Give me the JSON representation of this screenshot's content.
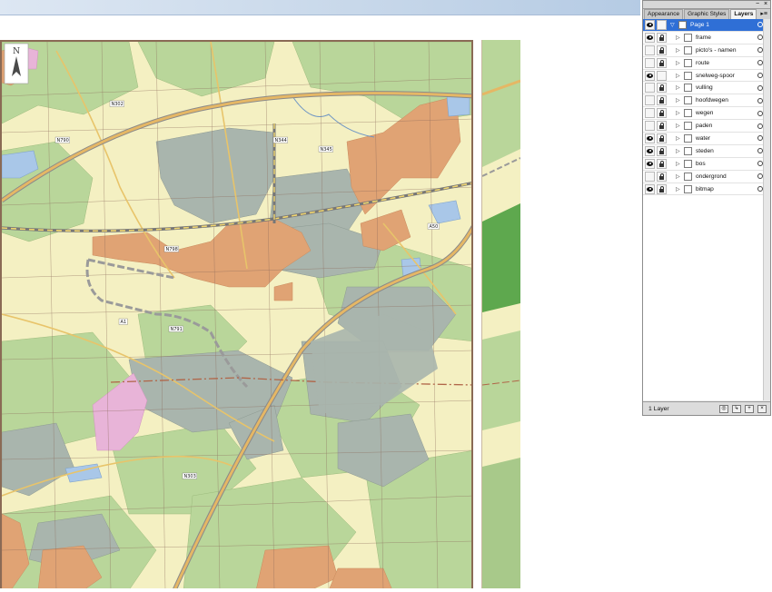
{
  "layers_panel": {
    "tabs": [
      {
        "label": "Appearance",
        "active": false
      },
      {
        "label": "Graphic Styles",
        "active": false
      },
      {
        "label": "Layers",
        "active": true
      }
    ],
    "menu_icon": "panel-menu-icon",
    "close_glyph": "×",
    "minimize_glyph": "−",
    "top_layer": {
      "name": "Page 1",
      "selected": true
    },
    "sublayers": [
      {
        "name": "frame",
        "visible": true,
        "locked": true
      },
      {
        "name": "picto's - namen",
        "visible": false,
        "locked": true
      },
      {
        "name": "route",
        "visible": false,
        "locked": true
      },
      {
        "name": "snelweg-spoor",
        "visible": true,
        "locked": false
      },
      {
        "name": "vulling",
        "visible": false,
        "locked": true
      },
      {
        "name": "hoofdwegen",
        "visible": false,
        "locked": true
      },
      {
        "name": "wegen",
        "visible": false,
        "locked": true
      },
      {
        "name": "paden",
        "visible": false,
        "locked": true
      },
      {
        "name": "water",
        "visible": true,
        "locked": true
      },
      {
        "name": "steden",
        "visible": true,
        "locked": true
      },
      {
        "name": "bos",
        "visible": true,
        "locked": true
      },
      {
        "name": "ondergrond",
        "visible": false,
        "locked": true
      },
      {
        "name": "bitmap",
        "visible": true,
        "locked": true
      }
    ],
    "footer_count": "1 Layer",
    "footer_buttons": [
      "make-clipping-mask",
      "create-sublayer",
      "create-layer",
      "delete-layer"
    ],
    "selection_color": "#2f6fd6"
  },
  "map": {
    "north_label": "N",
    "road_labels": [
      "N302",
      "N798",
      "N344",
      "N345",
      "A50",
      "A1",
      "N791",
      "N790",
      "N303"
    ],
    "colors": {
      "farmland": "#f4f0c2",
      "forest": "#b9d69a",
      "open_green": "#a8c98a",
      "heath": "#a9b5ad",
      "urban": "#e0a374",
      "industrial": "#e8b4d8",
      "water": "#a9c7e8",
      "highway": "#e5b765",
      "highway_casing": "#8a8a8a",
      "border": "#b06548"
    }
  }
}
